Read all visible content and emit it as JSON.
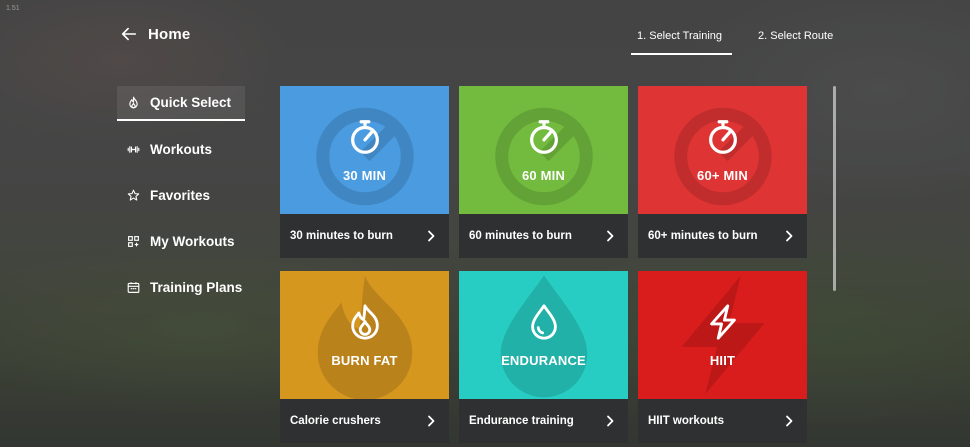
{
  "version": "1.51",
  "header": {
    "back_icon": "arrow-left-icon",
    "title": "Home",
    "steps": [
      {
        "label": "1. Select Training",
        "active": true
      },
      {
        "label": "2. Select Route",
        "active": false
      }
    ]
  },
  "sidebar": {
    "items": [
      {
        "label": "Quick Select",
        "icon": "flame-icon",
        "active": true
      },
      {
        "label": "Workouts",
        "icon": "dumbbell-icon",
        "active": false
      },
      {
        "label": "Favorites",
        "icon": "star-icon",
        "active": false
      },
      {
        "label": "My Workouts",
        "icon": "custom-workout-icon",
        "active": false
      },
      {
        "label": "Training Plans",
        "icon": "calendar-icon",
        "active": false
      }
    ]
  },
  "cards": [
    {
      "title": "30 MIN",
      "subtitle": "30 minutes to burn",
      "color": "#4a9be0",
      "icon": "stopwatch-icon"
    },
    {
      "title": "60 MIN",
      "subtitle": "60 minutes to burn",
      "color": "#73bb3f",
      "icon": "stopwatch-icon"
    },
    {
      "title": "60+ MIN",
      "subtitle": "60+ minutes to burn",
      "color": "#df3434",
      "icon": "stopwatch-icon"
    },
    {
      "title": "BURN FAT",
      "subtitle": "Calorie crushers",
      "color": "#d6971f",
      "icon": "flame-icon"
    },
    {
      "title": "ENDURANCE",
      "subtitle": "Endurance training",
      "color": "#27cdc3",
      "icon": "droplet-icon"
    },
    {
      "title": "HIIT",
      "subtitle": "HIIT workouts",
      "color": "#d91c1c",
      "icon": "lightning-icon"
    }
  ],
  "colors": {
    "card_footer": "#2f3031",
    "text": "#ffffff"
  }
}
